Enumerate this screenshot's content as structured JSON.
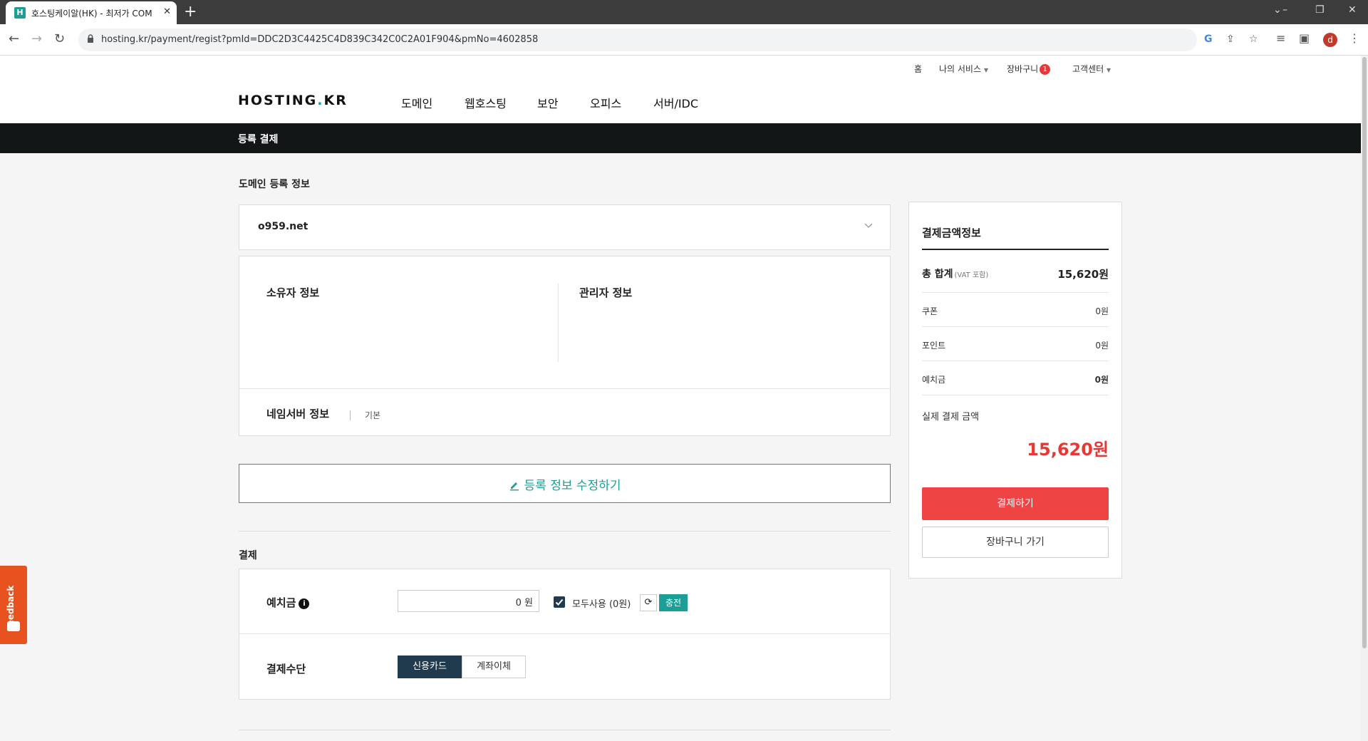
{
  "browser": {
    "tab_title": "호스팅케이알(HK) - 최저가 COM",
    "tab_favicon": "H",
    "tab_close": "✕",
    "new_tab": "+",
    "url": "hosting.kr/payment/regist?pmId=DDC2D3C4425C4D839C342C0C2A01F904&pmNo=4602858",
    "profile_initial": "d"
  },
  "util_nav": {
    "home": "홈",
    "my_services": "나의 서비스",
    "cart": "장바구니",
    "cart_count": "1",
    "support": "고객센터"
  },
  "logo": {
    "main": "HOSTING",
    "dot": ".",
    "suffix": "KR"
  },
  "gnb": [
    "도메인",
    "웹호스팅",
    "보안",
    "오피스",
    "서버/IDC"
  ],
  "page_title": "등록 결제",
  "domain_section": {
    "label": "도메인 등록 정보",
    "domain": "o959.net",
    "owner_title": "소유자 정보",
    "admin_title": "관리자 정보",
    "nameserver_title": "네임서버 정보",
    "nameserver_value": "기본"
  },
  "edit_button": "등록 정보 수정하기",
  "payment": {
    "label": "결제",
    "deposit_label": "예치금",
    "deposit_value": "0 원",
    "use_all_label": "모두사용 (0원)",
    "use_all_checked": true,
    "refresh_symbol": "⟳",
    "charge_button": "충전",
    "method_label": "결제수단",
    "methods": [
      "신용카드",
      "계좌이체"
    ],
    "selected_method": "신용카드"
  },
  "summary": {
    "title": "결제금액정보",
    "total_label": "총 합계",
    "total_note": "(VAT 포함)",
    "total_value": "15,620원",
    "coupon_label": "쿠폰",
    "coupon_value": "0원",
    "point_label": "포인트",
    "point_value": "0원",
    "deposit_label": "예치금",
    "deposit_value": "0원",
    "final_label": "실제 결제 금액",
    "final_value": "15,620원",
    "pay_button": "결제하기",
    "cart_button": "장바구니 가기"
  },
  "feedback_tab": "Feedback",
  "colors": {
    "accent": "#1a9e96",
    "dark": "#1f3b4d",
    "danger": "#ef4444",
    "title_bar": "#121617",
    "feedback": "#e8521e"
  }
}
